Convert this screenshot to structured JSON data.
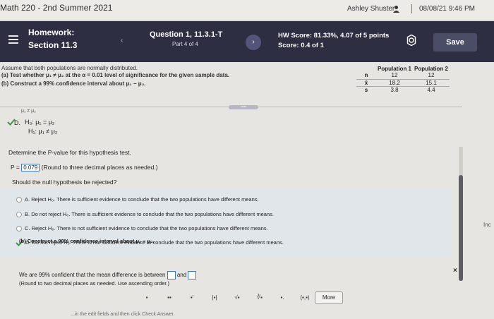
{
  "topbar": {
    "course": "Math 220 - 2nd Summer 2021",
    "user": "Ashley Shuster",
    "separator": "|",
    "datetime": "08/08/21 9:46 PM"
  },
  "hw_header": {
    "homework_label": "Homework:",
    "section": "Section 11.3",
    "question_title": "Question 1, 11.3.1-T",
    "part": "Part 4 of 4",
    "hw_score": "HW Score: 81.33%, 4.07 of 5 points",
    "score": "Score: 0.4 of 1",
    "save_label": "Save",
    "prev_glyph": "‹",
    "next_glyph": "›"
  },
  "question": {
    "stem_line": "Assume that both populations are normally distributed.",
    "part_a": "(a) Test whether μ₁ ≠ μ₂ at the α = 0.01 level of significance for the given sample data.",
    "part_b": "(b) Construct a 99% confidence interval about μ₁ − μ₂."
  },
  "data_table": {
    "headers": [
      "",
      "Population 1",
      "Population 2"
    ],
    "rows": [
      {
        "label": "n",
        "p1": "12",
        "p2": "12"
      },
      {
        "label": "x̄",
        "p1": "18.2",
        "p2": "15.1"
      },
      {
        "label": "s",
        "p1": "3.8",
        "p2": "4.4"
      }
    ]
  },
  "expander_label": "•••••",
  "hypothesis_cut": "μ₁ ≠ μ₂",
  "hypothesis_option": {
    "letter": "D.",
    "h0": "H₀: μ₁ = μ₂",
    "h1": "H₁: μ₁ ≠ μ₂"
  },
  "pvalue": {
    "instruction": "Determine the P-value for this hypothesis test.",
    "prefix": "P =",
    "value": "0.079",
    "note": "(Round to three decimal places as needed.)"
  },
  "reject_question": "Should the null hypothesis be rejected?",
  "options": [
    {
      "letter": "A.",
      "text": "Reject H₀. There is sufficient evidence to conclude that the two populations have different means."
    },
    {
      "letter": "B.",
      "text": "Do not reject H₀. There is sufficient evidence to conclude that the two populations have different means."
    },
    {
      "letter": "C.",
      "text": "Reject H₀. There is not sufficient evidence to conclude that the two populations have different means."
    },
    {
      "letter": "D.",
      "text": "Do not reject H₀. There is not sufficient evidence to conclude that the two populations have different means."
    }
  ],
  "confidence": {
    "label": "(b) Construct a 99% confidence interval about μ₁ − μ₂.",
    "sentence_start": "We are 99% confident that the mean difference is between",
    "and_word": "and",
    "note": "(Round to two decimal places as needed. Use ascending order.)"
  },
  "edge_text": "Inc",
  "close_glyph": "×",
  "toolbar": {
    "buttons": [
      "▪",
      "▪▪",
      "▪′",
      "|▪|",
      "√▪",
      "∛▪",
      "▪.",
      "(▪,▪)"
    ],
    "more_label": "More"
  },
  "footer": "...in the edit fields and then click Check Answer."
}
